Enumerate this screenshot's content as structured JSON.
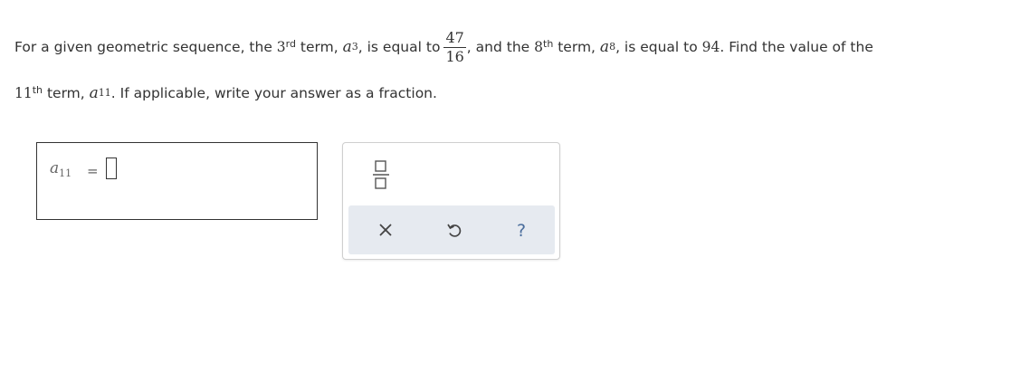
{
  "question": {
    "line1": {
      "t1": "For a given geometric sequence, the",
      "n3": "3",
      "sup_rd": "rd",
      "t2": "term,",
      "var_a": "a",
      "sub_3": "3",
      "comma": ",",
      "t3": "is equal to",
      "frac_num": "47",
      "frac_den": "16",
      "t4": ", and the",
      "n8": "8",
      "sup_th": "th",
      "t5": "term,",
      "sub_8": "8",
      "t6": ", is equal to",
      "val94": "94",
      "t7": ". Find the value of the"
    },
    "line2": {
      "n11": "11",
      "sup_th": "th",
      "t1": "term,",
      "var_a": "a",
      "sub_11": "11",
      "t2": ". If applicable, write your answer as a fraction."
    }
  },
  "answer": {
    "var": "a",
    "sub": "11",
    "equals": "=",
    "value": ""
  },
  "tools": {
    "fraction_icon": "fraction-template-icon",
    "clear_icon": "x-icon",
    "undo_icon": "undo-icon",
    "help_icon": "question-mark-icon",
    "help_glyph": "?",
    "accent": "#8aa0bd",
    "bar_bg": "#e6eaf0"
  }
}
